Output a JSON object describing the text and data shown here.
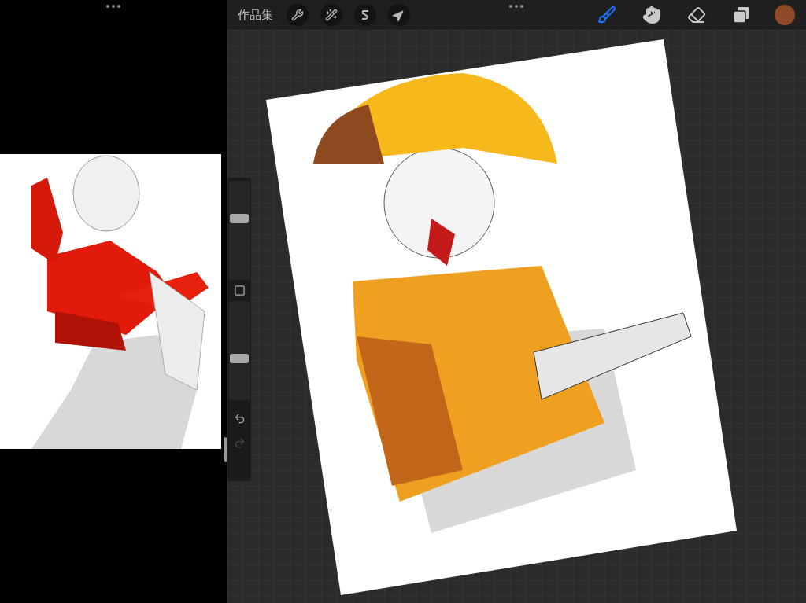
{
  "toolbar": {
    "gallery_label": "作品集",
    "actions": [
      {
        "kind": "wrench"
      },
      {
        "kind": "wand"
      },
      {
        "kind": "selection"
      },
      {
        "kind": "transform"
      }
    ],
    "tools": [
      {
        "kind": "brush",
        "selected": true
      },
      {
        "kind": "smudge",
        "selected": false
      },
      {
        "kind": "eraser",
        "selected": false
      },
      {
        "kind": "layers",
        "selected": false
      }
    ],
    "color": "#8f4a2a"
  },
  "sidebar": {
    "sliders": [
      {
        "level": 0.62
      },
      {
        "level": 0.42
      }
    ],
    "undo": {
      "disabled": false
    },
    "redo": {
      "disabled": true
    }
  }
}
